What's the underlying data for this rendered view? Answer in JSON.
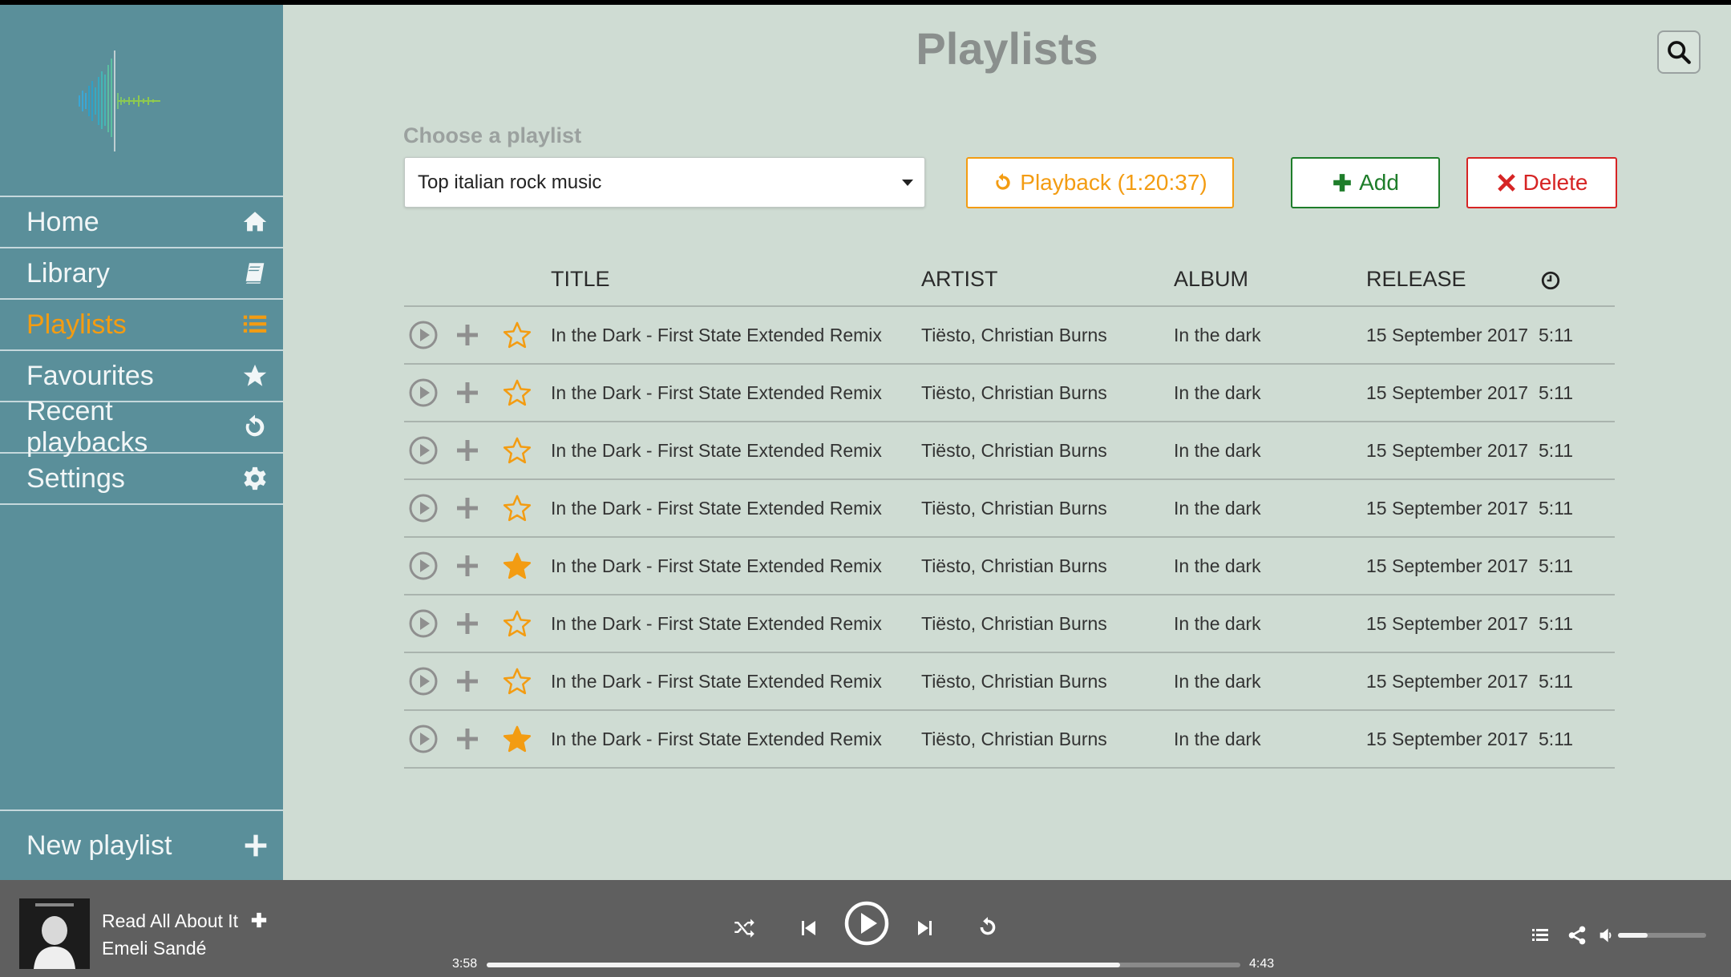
{
  "page_title": "Playlists",
  "sidebar": {
    "items": [
      {
        "label": "Home",
        "icon": "home-icon",
        "active": false
      },
      {
        "label": "Library",
        "icon": "book-icon",
        "active": false
      },
      {
        "label": "Playlists",
        "icon": "list-icon",
        "active": true
      },
      {
        "label": "Favourites",
        "icon": "star-icon",
        "active": false
      },
      {
        "label": "Recent playbacks",
        "icon": "history-icon",
        "active": false
      },
      {
        "label": "Settings",
        "icon": "gear-icon",
        "active": false
      }
    ],
    "new_playlist_label": "New playlist"
  },
  "toolbar": {
    "choose_label": "Choose a playlist",
    "selected_playlist": "Top italian rock music",
    "playback_label": "Playback (1:20:37)",
    "add_label": "Add",
    "delete_label": "Delete"
  },
  "table": {
    "headers": [
      "TITLE",
      "ARTIST",
      "ALBUM",
      "RELEASE"
    ],
    "duration_icon": "clock-icon",
    "rows": [
      {
        "title": "In the Dark - First State Extended Remix",
        "artist": "Tiësto, Christian Burns",
        "album": "In the dark",
        "release": "15 September 2017",
        "duration": "5:11",
        "favourite": false
      },
      {
        "title": "In the Dark - First State Extended Remix",
        "artist": "Tiësto, Christian Burns",
        "album": "In the dark",
        "release": "15 September 2017",
        "duration": "5:11",
        "favourite": false
      },
      {
        "title": "In the Dark - First State Extended Remix",
        "artist": "Tiësto, Christian Burns",
        "album": "In the dark",
        "release": "15 September 2017",
        "duration": "5:11",
        "favourite": false
      },
      {
        "title": "In the Dark - First State Extended Remix",
        "artist": "Tiësto, Christian Burns",
        "album": "In the dark",
        "release": "15 September 2017",
        "duration": "5:11",
        "favourite": false
      },
      {
        "title": "In the Dark - First State Extended Remix",
        "artist": "Tiësto, Christian Burns",
        "album": "In the dark",
        "release": "15 September 2017",
        "duration": "5:11",
        "favourite": true
      },
      {
        "title": "In the Dark - First State Extended Remix",
        "artist": "Tiësto, Christian Burns",
        "album": "In the dark",
        "release": "15 September 2017",
        "duration": "5:11",
        "favourite": false
      },
      {
        "title": "In the Dark - First State Extended Remix",
        "artist": "Tiësto, Christian Burns",
        "album": "In the dark",
        "release": "15 September 2017",
        "duration": "5:11",
        "favourite": false
      },
      {
        "title": "In the Dark - First State Extended Remix",
        "artist": "Tiësto, Christian Burns",
        "album": "In the dark",
        "release": "15 September 2017",
        "duration": "5:11",
        "favourite": true
      }
    ]
  },
  "player": {
    "track_title": "Read All About It",
    "track_artist": "Emeli Sandé",
    "current_time": "3:58",
    "total_time": "4:43",
    "progress": 0.84,
    "volume": 0.34
  },
  "colors": {
    "sidebar": "#5a8f9a",
    "main_bg": "#cfdcd3",
    "accent": "#f39c12",
    "add": "#1e7d2a",
    "delete": "#d62424",
    "player_bg": "#5f5f5f"
  }
}
